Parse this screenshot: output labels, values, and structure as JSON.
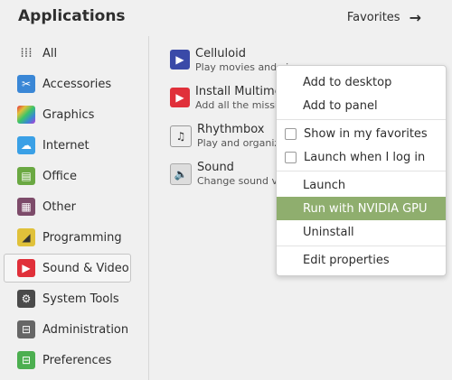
{
  "header": {
    "title": "Applications",
    "favorites_label": "Favorites",
    "favorites_icon": "arrow-right-icon"
  },
  "categories": [
    {
      "label": "All",
      "icon": "grid-icon",
      "color": "#555555"
    },
    {
      "label": "Accessories",
      "icon": "scissors-icon",
      "color": "#3a87d6"
    },
    {
      "label": "Graphics",
      "icon": "rainbow-icon",
      "color": "#d63ab8"
    },
    {
      "label": "Internet",
      "icon": "cloud-icon",
      "color": "#3aa0e6"
    },
    {
      "label": "Office",
      "icon": "office-icon",
      "color": "#6aa842"
    },
    {
      "label": "Other",
      "icon": "apps-icon",
      "color": "#7d4b6a"
    },
    {
      "label": "Programming",
      "icon": "programming-icon",
      "color": "#e0c13a"
    },
    {
      "label": "Sound & Video",
      "icon": "play-icon",
      "color": "#e0303a",
      "selected": true
    },
    {
      "label": "System Tools",
      "icon": "gear-icon",
      "color": "#4a4a4a"
    },
    {
      "label": "Administration",
      "icon": "toggle-icon",
      "color": "#666666"
    },
    {
      "label": "Preferences",
      "icon": "settings-toggle-icon",
      "color": "#4caf50"
    }
  ],
  "apps": [
    {
      "name": "Celluloid",
      "desc": "Play movies and vi",
      "icon": "celluloid-icon",
      "color": "#3a4aa8"
    },
    {
      "name": "Install Multime",
      "desc": "Add all the missin",
      "icon": "play-icon",
      "color": "#e0303a"
    },
    {
      "name": "Rhythmbox",
      "desc": "Play and organize",
      "icon": "music-note-icon",
      "color": "#eeeeee"
    },
    {
      "name": "Sound",
      "desc": "Change sound vol",
      "icon": "speaker-icon",
      "color": "#dddddd"
    }
  ],
  "context_menu": {
    "items": [
      {
        "label": "Add to desktop",
        "type": "item"
      },
      {
        "label": "Add to panel",
        "type": "item"
      },
      {
        "type": "separator"
      },
      {
        "label": "Show in my favorites",
        "type": "check",
        "checked": false
      },
      {
        "label": "Launch when I log in",
        "type": "check",
        "checked": false
      },
      {
        "type": "separator"
      },
      {
        "label": "Launch",
        "type": "item"
      },
      {
        "label": "Run with NVIDIA GPU",
        "type": "item",
        "highlighted": true
      },
      {
        "label": "Uninstall",
        "type": "item"
      },
      {
        "type": "separator"
      },
      {
        "label": "Edit properties",
        "type": "item"
      }
    ]
  },
  "colors": {
    "highlight": "#8fae6e",
    "background": "#f0f0f0"
  }
}
